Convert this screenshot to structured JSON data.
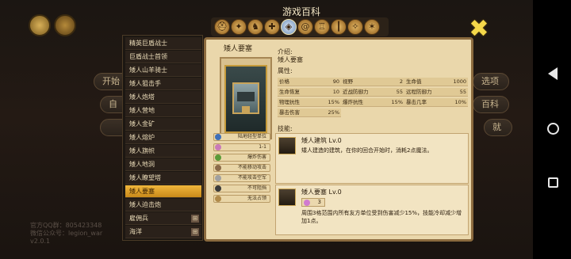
{
  "screen_title": "游戏百科",
  "background": {
    "menu_labels": [
      "开始",
      "自",
      "选项",
      "百科",
      "就"
    ],
    "qq_group": "官方QQ群：805423348",
    "wechat": "微信公众号：legion_war",
    "version": "v2.0.1"
  },
  "tabs": [
    {
      "icon": "helmet-icon",
      "glyph": "⛑"
    },
    {
      "icon": "wing-icon",
      "glyph": "✦"
    },
    {
      "icon": "horse-icon",
      "glyph": "♞"
    },
    {
      "icon": "cross-icon",
      "glyph": "✚"
    },
    {
      "icon": "shield-icon",
      "glyph": "◈",
      "active": true
    },
    {
      "icon": "spiral-icon",
      "glyph": "@"
    },
    {
      "icon": "tower-icon",
      "glyph": "♖"
    },
    {
      "icon": "staff-icon",
      "glyph": "┃"
    },
    {
      "icon": "star-icon",
      "glyph": "✧"
    },
    {
      "icon": "beast-icon",
      "glyph": "✶"
    },
    {
      "icon": "sun-icon",
      "glyph": "☼"
    }
  ],
  "unit_list": [
    {
      "label": "精英巨盾战士"
    },
    {
      "label": "巨盾战士首领"
    },
    {
      "label": "矮人山羊骑士"
    },
    {
      "label": "矮人狙击手"
    },
    {
      "label": "矮人炮塔"
    },
    {
      "label": "矮人营地"
    },
    {
      "label": "矮人金矿"
    },
    {
      "label": "矮人熔炉"
    },
    {
      "label": "矮人旗帜"
    },
    {
      "label": "矮人地洞"
    },
    {
      "label": "矮人瞭望塔"
    },
    {
      "label": "矮人要塞",
      "active": true
    },
    {
      "label": "矮人迫击炮"
    },
    {
      "label": "雇佣兵",
      "expandable": true
    },
    {
      "label": "海洋",
      "expandable": true
    }
  ],
  "unit": {
    "name": "矮人要塞",
    "intro_label": "介绍:",
    "intro_text": "矮人要塞",
    "attributes_label": "属性:",
    "skills_label": "技能:",
    "tags": [
      {
        "text": "陆地轻型单位",
        "icon": "type-icon",
        "color": "#3f6fb8"
      },
      {
        "text": "1-1",
        "icon": "range-icon",
        "color": "#c97ab8"
      },
      {
        "text": "爆炸伤害",
        "icon": "explosion-icon",
        "color": "#5a9a38"
      },
      {
        "text": "不能移动攻击",
        "icon": "no-move-icon",
        "color": "#8a6a4a"
      },
      {
        "text": "不能攻击空军",
        "icon": "no-air-icon",
        "color": "#a0a0a0"
      },
      {
        "text": "不可阻挡",
        "icon": "unstoppable-icon",
        "color": "#3a3a3a"
      },
      {
        "text": "无法占领",
        "icon": "no-capture-icon",
        "color": "#b08a4a"
      }
    ],
    "stats": [
      [
        {
          "k": "价格",
          "v": "90"
        },
        {
          "k": "视野",
          "v": "2"
        },
        {
          "k": "生命值",
          "v": "1000"
        }
      ],
      [
        {
          "k": "生命恢复",
          "v": "10"
        },
        {
          "k": "近战防御力",
          "v": "55"
        },
        {
          "k": "远程防御力",
          "v": "55"
        }
      ],
      [
        {
          "k": "物理抗性",
          "v": "15%"
        },
        {
          "k": "爆炸抗性",
          "v": "15%"
        },
        {
          "k": "暴击几率",
          "v": "10%"
        }
      ],
      [
        {
          "k": "暴击伤害",
          "v": "25%"
        }
      ]
    ],
    "skills": [
      {
        "name": "矮人建筑 Lv.0",
        "desc": "矮人建造的建筑，在你的回合开始时，消耗2点魔法。",
        "icon": "building-icon"
      },
      {
        "name": "矮人要塞 Lv.0",
        "cost": "3",
        "desc": "周围3格范围内所有友方单位受到伤害减少15%，技能冷却减少增加1点。",
        "icon": "fortress-skill-icon"
      }
    ]
  },
  "nav": {
    "back": "back-icon",
    "home": "home-icon",
    "recent": "recent-apps-icon"
  }
}
